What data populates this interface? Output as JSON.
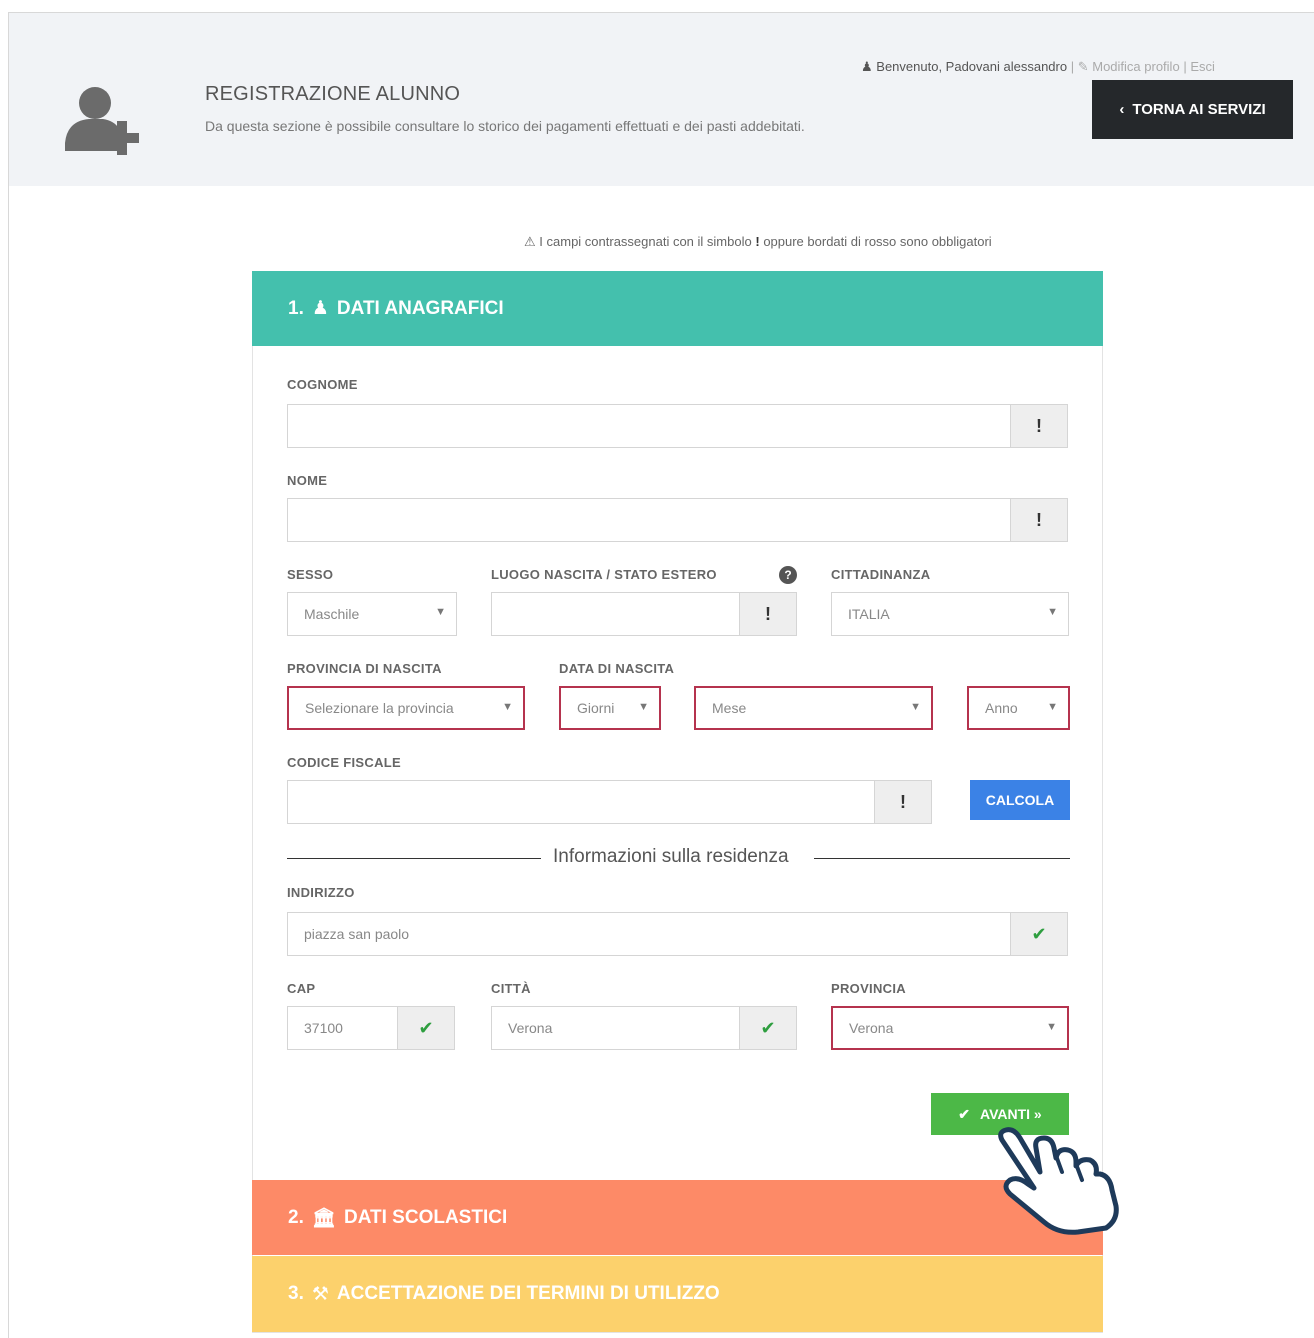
{
  "header": {
    "title": "REGISTRAZIONE ALUNNO",
    "subtitle": "Da questa sezione è possibile consultare lo storico dei pagamenti effettuati e dei pasti addebitati.",
    "welcome": "Benvenuto, Padovani alessandro",
    "edit_profile": "Modifica profilo",
    "logout": "Esci",
    "back_button": "TORNA AI SERVIZI"
  },
  "required_note": {
    "prefix": "I campi contrassegnati con il simbolo",
    "symbol": "!",
    "suffix": "oppure bordati di rosso sono obbligatori"
  },
  "sections": {
    "s1": {
      "number": "1.",
      "title": "DATI ANAGRAFICI"
    },
    "s2": {
      "number": "2.",
      "title": "DATI SCOLASTICI"
    },
    "s3": {
      "number": "3.",
      "title": "ACCETTAZIONE DEI TERMINI DI UTILIZZO"
    }
  },
  "form": {
    "cognome": {
      "label": "COGNOME",
      "value": ""
    },
    "nome": {
      "label": "NOME",
      "value": ""
    },
    "sesso": {
      "label": "SESSO",
      "value": "Maschile"
    },
    "luogo": {
      "label": "LUOGO NASCITA / STATO ESTERO",
      "value": ""
    },
    "cittadinanza": {
      "label": "CITTADINANZA",
      "value": "ITALIA"
    },
    "provincia_nascita": {
      "label": "PROVINCIA DI NASCITA",
      "value": "Selezionare la provincia"
    },
    "data_nascita": {
      "label": "DATA DI NASCITA",
      "giorno": "Giorni",
      "mese": "Mese",
      "anno": "Anno"
    },
    "codice_fiscale": {
      "label": "CODICE FISCALE",
      "value": ""
    },
    "calcola": "CALCOLA",
    "residenza_title": "Informazioni sulla residenza",
    "indirizzo": {
      "label": "INDIRIZZO",
      "value": "piazza san paolo"
    },
    "cap": {
      "label": "CAP",
      "value": "37100"
    },
    "citta": {
      "label": "CITTÀ",
      "value": "Verona"
    },
    "provincia": {
      "label": "PROVINCIA",
      "value": "Verona"
    },
    "required_symbol": "!",
    "next": "AVANTI »"
  },
  "colors": {
    "section1": "#44c0ad",
    "section2": "#fd8a67",
    "section3": "#fcd16c",
    "calc": "#3b82e6",
    "next": "#4cb847",
    "required_border": "#b5334e"
  }
}
